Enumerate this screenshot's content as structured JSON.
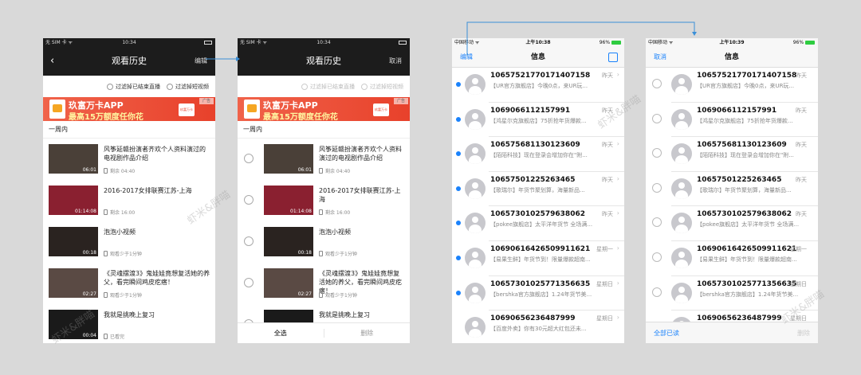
{
  "android": {
    "carrier": "无 SIM 卡 ᯤ",
    "time": "10:34",
    "title": "观看历史",
    "back_icon": "‹",
    "edit_label": "编辑",
    "cancel_label": "取消",
    "filters": [
      "过滤掉已结束直播",
      "过滤掉短视频"
    ],
    "banner": {
      "line1": "玖富万卡APP",
      "line2": "最高15万额度任你花",
      "logo": "玖富万卡",
      "ad": "广告"
    },
    "section": "一周内",
    "videos": [
      {
        "title": "风筝延赣扮演者齐欢个人资料演过的电视剧作品介绍",
        "duration": "06:01",
        "meta": "剩余 04:40",
        "thumb": "#4a4038"
      },
      {
        "title": "2016-2017女排联赛江苏-上海",
        "duration": "01:14:08",
        "meta": "剩余 16:00",
        "thumb": "#8a2030"
      },
      {
        "title": "泡泡小视频",
        "duration": "00:18",
        "meta": "观看少于1分钟",
        "thumb": "#2a2320"
      },
      {
        "title": "《灵魂摆渡3》鬼娃娃竟想复活她的养父，看完瞬间鸡皮疙瘩！",
        "duration": "02:27",
        "meta": "观看少于1分钟",
        "thumb": "#5a4a44"
      },
      {
        "title": "我就是挑晚上复习",
        "duration": "00:04",
        "meta": "已看完",
        "thumb": "#1a1a1a"
      }
    ],
    "select_all": "全选",
    "delete": "删除"
  },
  "ios": {
    "carrier": "中国移动 ᯤ",
    "time1": "上午10:38",
    "time2": "上午10:39",
    "battery": "96%",
    "title": "信息",
    "edit_label": "编辑",
    "cancel_label": "取消",
    "mark_all_read": "全部已读",
    "delete": "删除",
    "messages": [
      {
        "number": "10657521770171407158",
        "time": "昨天",
        "preview": "【UR官方旗舰店】今晚0点，来UR玩..."
      },
      {
        "number": "1069066112157991",
        "time": "昨天",
        "preview": "【鸿星尔克旗舰店】75折抢年货爆款..."
      },
      {
        "number": "106575681130123609",
        "time": "昨天",
        "preview": "【陌陌科技】现在登录会增加你在\"附..."
      },
      {
        "number": "10657501225263465",
        "time": "昨天",
        "preview": "【歌瑞尔】年货节聚划算，海量新品..."
      },
      {
        "number": "1065730102579638062",
        "time": "昨天",
        "preview": "【pokee旗舰店】太平洋年货节 全场满..."
      },
      {
        "number": "10690616426509911621",
        "time": "星期一",
        "preview": "【易果生鲜】年货节到！限量爆款超南..."
      },
      {
        "number": "10657301025771356635",
        "time": "星期日",
        "preview": "【bershka官方旗舰店】1.24年货节美..."
      },
      {
        "number": "10690656236487999",
        "time": "星期日",
        "preview": "【百度外卖】你有30元超大红包还未..."
      }
    ],
    "unread": [
      true,
      true,
      true,
      true,
      true,
      true,
      true,
      false
    ]
  },
  "watermark": "虾米&胖喵",
  "colors": {
    "ios_blue": "#1a82fb",
    "banner_red": "#e8412b",
    "dark_header": "#1c1c1c"
  }
}
